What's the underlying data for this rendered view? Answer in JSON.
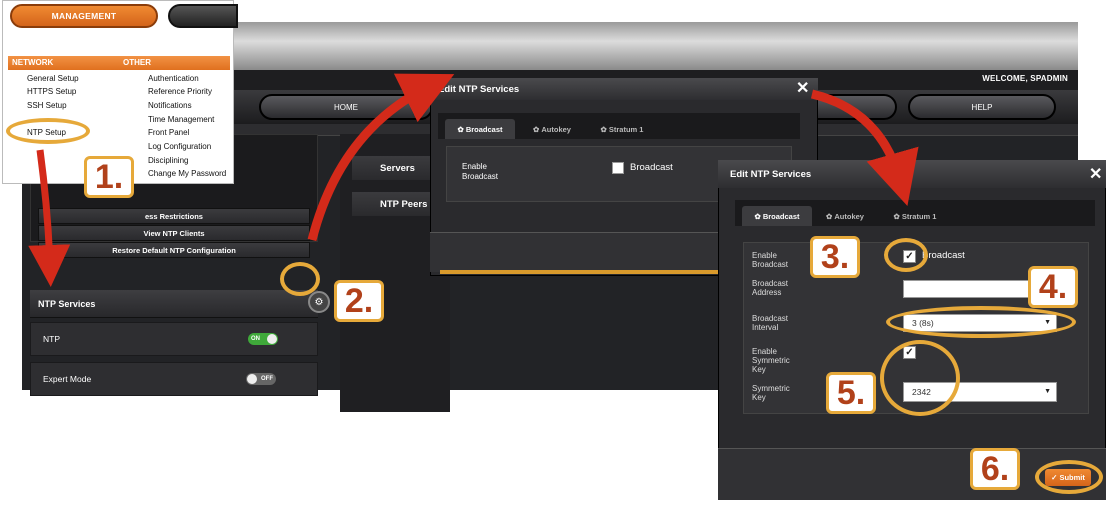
{
  "app": {
    "welcome": "WELCOME, SPADMIN",
    "nav": {
      "home": "HOME",
      "help": "HELP"
    },
    "left_rows": {
      "access_restrictions": "ess Restrictions",
      "view_clients": "View NTP Clients",
      "restore_default": "Restore Default NTP Configuration"
    },
    "ntp_services": {
      "title": "NTP Services",
      "ntp_label": "NTP",
      "ntp_toggle": "ON",
      "expert_label": "Expert Mode",
      "expert_toggle": "OFF"
    },
    "middle": {
      "servers": "Servers",
      "peers": "NTP Peers"
    }
  },
  "management_menu": {
    "tab_label": "MANAGEMENT",
    "col1_header": "NETWORK",
    "col2_header": "OTHER",
    "network_items": [
      "General Setup",
      "HTTPS Setup",
      "SSH Setup",
      "NTP Setup"
    ],
    "other_items": [
      "Authentication",
      "Reference Priority",
      "Notifications",
      "Time Management",
      "Front Panel",
      "Log Configuration",
      "Disciplining",
      "Change My Password"
    ]
  },
  "modal1": {
    "title": "Edit NTP Services",
    "close": "✕",
    "tabs": [
      "Broadcast",
      "Autokey",
      "Stratum 1"
    ],
    "enable_label": "Enable\nBroadcast",
    "checkbox_label": "Broadcast"
  },
  "modal2": {
    "title": "Edit NTP Services",
    "close": "✕",
    "tabs": [
      "Broadcast",
      "Autokey",
      "Stratum 1"
    ],
    "enable_broadcast_label": "Enable\nBroadcast",
    "broadcast_checkbox_label": "Broadcast",
    "broadcast_address_label": "Broadcast\nAddress",
    "broadcast_address_value": "",
    "broadcast_interval_label": "Broadcast\nInterval",
    "broadcast_interval_value": "3 (8s)",
    "enable_symmetric_label": "Enable\nSymmetric\nKey",
    "symmetric_key_label": "Symmetric\nKey",
    "symmetric_key_value": "2342",
    "submit": "Submit"
  },
  "steps": [
    "1.",
    "2.",
    "3.",
    "4.",
    "5.",
    "6."
  ],
  "colors": {
    "accent_orange": "#e0701f",
    "annotation_gold": "#e6a93a",
    "arrow_red": "#d42a1a",
    "step_text": "#b1411a"
  }
}
